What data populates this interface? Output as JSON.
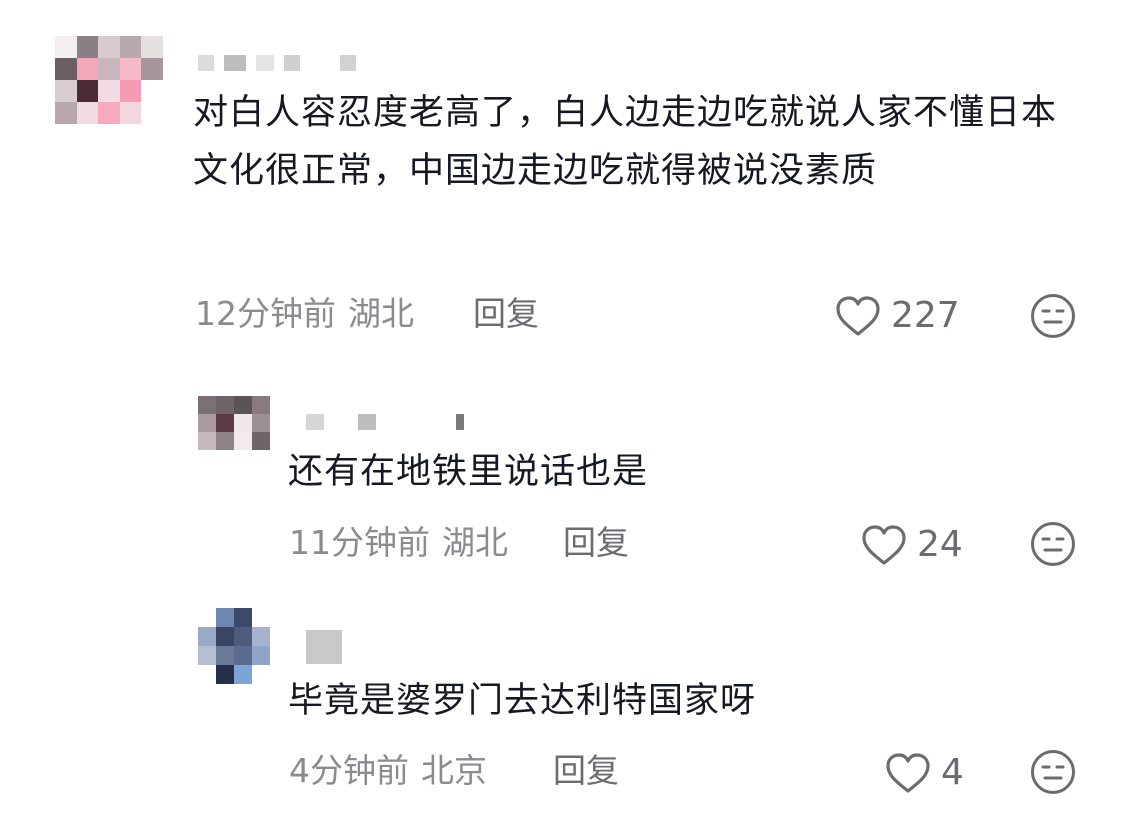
{
  "comments": [
    {
      "text": "对白人容忍度老高了，白人边走边吃就说人家不懂日本文化很正常，中国边走边吃就得被说没素质",
      "time": "12分钟前",
      "location": "湖北",
      "reply_label": "回复",
      "likes": "227",
      "like_icon": "heart-outline",
      "dislike_icon": "meh-face"
    },
    {
      "text": "还有在地铁里说话也是",
      "time": "11分钟前",
      "location": "湖北",
      "reply_label": "回复",
      "likes": "24",
      "like_icon": "heart-outline",
      "dislike_icon": "meh-face"
    },
    {
      "text": "毕竟是婆罗门去达利特国家呀",
      "time": "4分钟前",
      "location": "北京",
      "reply_label": "回复",
      "likes": "4",
      "like_icon": "heart-outline",
      "dislike_icon": "meh-face"
    }
  ],
  "colors": {
    "text": "#161823",
    "meta": "#8a8b91",
    "icon": "#6b6c72"
  }
}
